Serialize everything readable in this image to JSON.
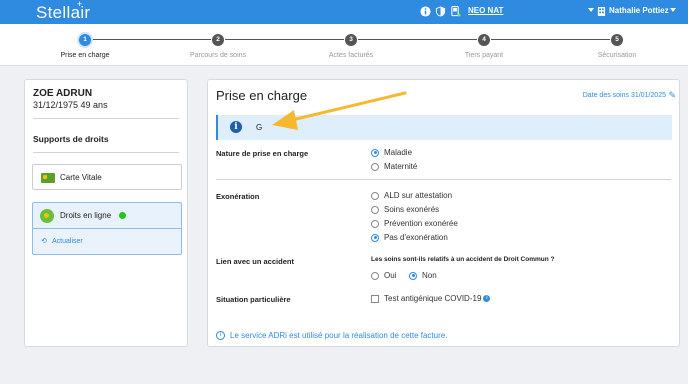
{
  "app": {
    "brand": "Stellair",
    "brand_plus": "+"
  },
  "topbar": {
    "icons": [
      "info-icon",
      "shield-icon",
      "device-icon"
    ],
    "organization": "NEO NAT",
    "user": "Nathalie Pottiez",
    "user_icon": "building-icon"
  },
  "stepper": {
    "steps": [
      {
        "number": "1",
        "label": "Prise en charge",
        "active": true
      },
      {
        "number": "2",
        "label": "Parcours de soins",
        "active": false
      },
      {
        "number": "3",
        "label": "Actes facturés",
        "active": false
      },
      {
        "number": "4",
        "label": "Tiers payant",
        "active": false
      },
      {
        "number": "5",
        "label": "Sécurisation",
        "active": false
      }
    ]
  },
  "patient": {
    "name": "ZOE ADRUN",
    "dob_age": "31/12/1975 49 ans",
    "supports_title": "Supports de droits",
    "carte_vitale": "Carte Vitale",
    "droits_en_ligne": "Droits en ligne",
    "actualiser": "Actualiser"
  },
  "main": {
    "title": "Prise en charge",
    "date_link": "Date des soins 31/01/2025",
    "info_text": "G",
    "nature": {
      "label": "Nature de prise en charge",
      "options": [
        {
          "label": "Maladie",
          "checked": true
        },
        {
          "label": "Maternité",
          "checked": false
        }
      ]
    },
    "exoneration": {
      "label": "Exonération",
      "options": [
        {
          "label": "ALD sur attestation",
          "checked": false
        },
        {
          "label": "Soins exonérés",
          "checked": false
        },
        {
          "label": "Prévention exonérée",
          "checked": false
        },
        {
          "label": "Pas d'exonération",
          "checked": true
        }
      ]
    },
    "accident": {
      "label": "Lien avec un accident",
      "question": "Les soins sont-ils relatifs à un accident de Droit Commun ?",
      "options": [
        {
          "label": "Oui",
          "checked": false
        },
        {
          "label": "Non",
          "checked": true
        }
      ]
    },
    "situation": {
      "label": "Situation particulière",
      "checkbox_label": "Test antigénique COVID-19",
      "checked": false
    },
    "footnote": "Le service ADRi est utilisé pour la réalisation de cette facture."
  },
  "colors": {
    "accent": "#2f8be0",
    "arrow": "#f5b82e",
    "online": "#22c51c"
  }
}
